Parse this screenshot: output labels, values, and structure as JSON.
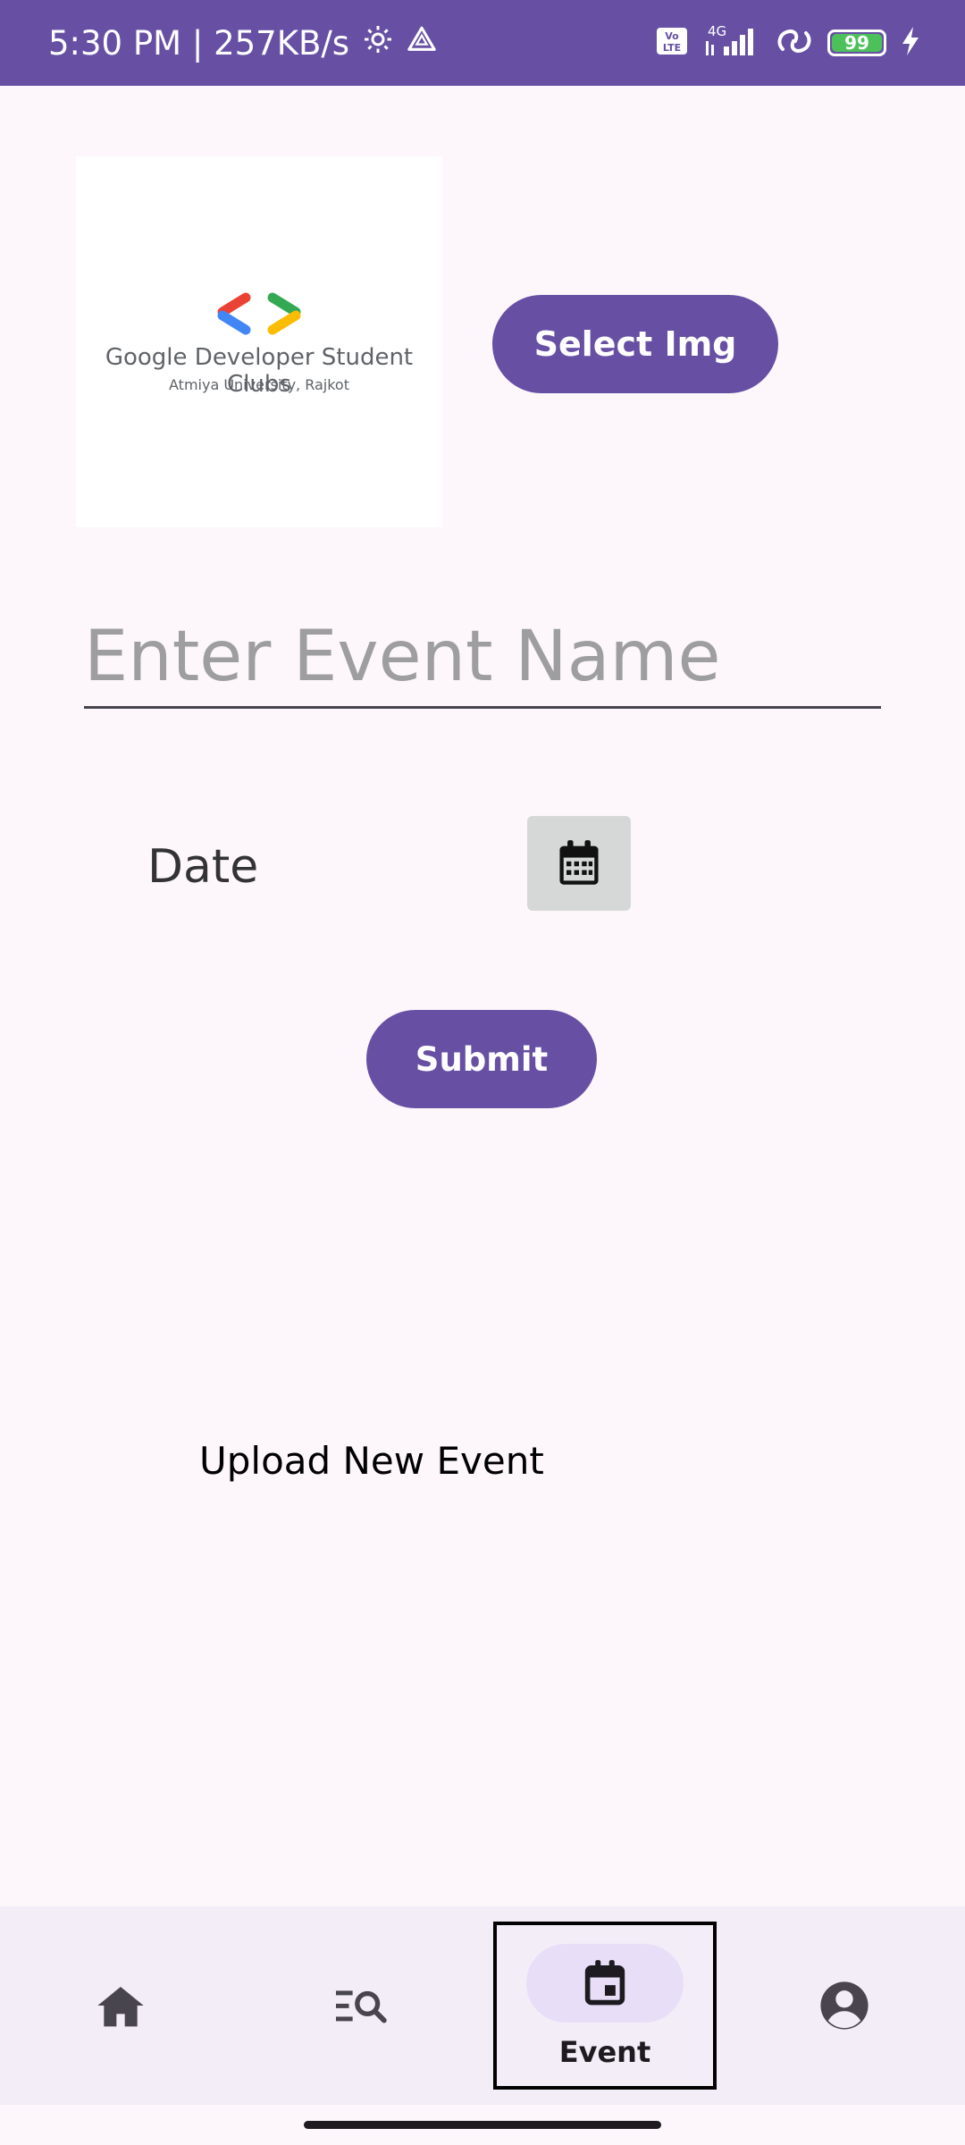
{
  "status_bar": {
    "time_speed": "5:30 PM | 257KB/s",
    "network": "4G",
    "volte": "Vo LTE",
    "battery": "99"
  },
  "event_image": {
    "logo_name": "Google Developer Student Clubs",
    "logo_sub": "Atmiya University, Rajkot",
    "logo_colors": [
      "#ea4335",
      "#4285f4",
      "#34a853",
      "#fbbc04"
    ]
  },
  "select_button": {
    "label": "Select Img"
  },
  "event_name": {
    "placeholder": "Enter Event Name",
    "value": ""
  },
  "date": {
    "label": "Date"
  },
  "submit_button": {
    "label": "Submit"
  },
  "caption": "Upload New Event",
  "bottom_nav": {
    "items": [
      {
        "icon": "home-icon",
        "label": "",
        "active": false
      },
      {
        "icon": "search-list-icon",
        "label": "",
        "active": false
      },
      {
        "icon": "calendar-event-icon",
        "label": "Event",
        "active": true
      },
      {
        "icon": "account-circle-icon",
        "label": "",
        "active": false
      }
    ]
  },
  "colors": {
    "primary": "#6750a4",
    "background": "#fdf7fb",
    "nav_background": "#f3edf7",
    "nav_indicator": "#e8def8"
  }
}
